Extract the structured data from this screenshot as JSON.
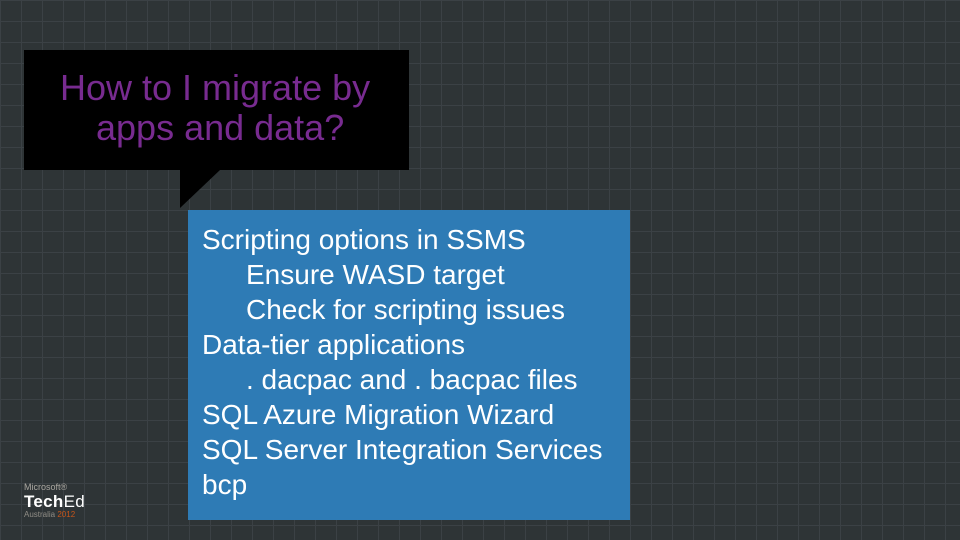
{
  "question": {
    "line1": "How to I migrate by",
    "line2": "apps and data?"
  },
  "answer": {
    "items": [
      {
        "text": "Scripting options in SSMS",
        "indent": 0
      },
      {
        "text": "Ensure WASD target",
        "indent": 1
      },
      {
        "text": "Check for scripting issues",
        "indent": 1
      },
      {
        "text": "Data-tier applications",
        "indent": 0
      },
      {
        "text": ". dacpac and . bacpac files",
        "indent": 1
      },
      {
        "text": "SQL Azure Migration Wizard",
        "indent": 0
      },
      {
        "text": "SQL Server Integration Services",
        "indent": 0
      },
      {
        "text": "bcp",
        "indent": 0
      }
    ]
  },
  "brand": {
    "vendor": "Microsoft®",
    "product_prefix": "Tech",
    "product_suffix": "Ed",
    "region": "Australia",
    "year": "2012"
  },
  "colors": {
    "question_bg": "#000000",
    "question_fg": "#782b90",
    "answer_bg": "#2e7bb5",
    "answer_fg": "#ffffff",
    "slide_bg": "#2e3436",
    "grid": "#3b4145",
    "year": "#c6551a"
  }
}
